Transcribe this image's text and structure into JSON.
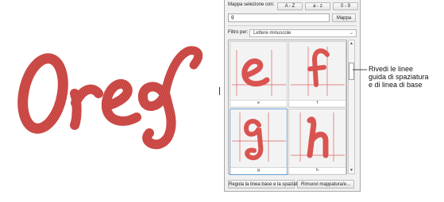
{
  "colors": {
    "thread": "#d9534f",
    "thread_dark": "#a8322e",
    "guide": "#e06060"
  },
  "panel": {
    "mapping_label": "Mappa selezione con:",
    "sort_buttons": [
      "A - Z",
      "a - z",
      "0 - 9"
    ],
    "char_input_value": "g",
    "map_button": "Mappa",
    "filter_label": "Filtro per:",
    "filter_value": "Lettere minuscole",
    "glyph_cells": [
      {
        "letter": "e",
        "caption": "e"
      },
      {
        "letter": "f",
        "caption": "f"
      },
      {
        "letter": "g",
        "caption": "g"
      },
      {
        "letter": "h",
        "caption": "h"
      }
    ],
    "adjust_button": "Regola la linea base e la spaziat",
    "remove_button": "Rimuovi mappatura/e..."
  },
  "artwork": {
    "text": "Oreg"
  },
  "callout": {
    "line1": "Rivedi le linee",
    "line2": "guida di spaziatura",
    "line3": "e di linea di base"
  }
}
